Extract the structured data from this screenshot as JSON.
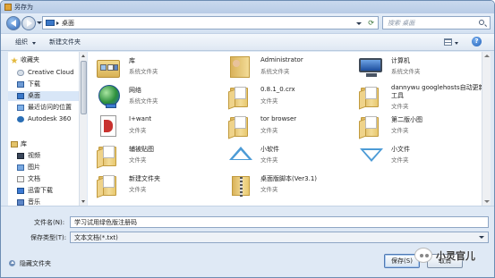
{
  "window": {
    "title": "另存为"
  },
  "address": {
    "location": "桌面",
    "search_placeholder": "搜索 桌面"
  },
  "toolbar": {
    "organize": "组织",
    "new_folder": "新建文件夹",
    "help": "?"
  },
  "nav": {
    "items": [
      {
        "label": "收藏夹",
        "icon": "star-icon",
        "header": true
      },
      {
        "label": "Creative Cloud",
        "icon": "cloud-icon"
      },
      {
        "label": "下载",
        "icon": "download-folder-icon"
      },
      {
        "label": "桌面",
        "icon": "desktop-icon",
        "selected": true
      },
      {
        "label": "最近访问的位置",
        "icon": "recent-places-icon"
      },
      {
        "label": "Autodesk 360",
        "icon": "autodesk-icon"
      },
      {
        "label": "库",
        "icon": "library-icon",
        "header": true
      },
      {
        "label": "视频",
        "icon": "video-library-icon"
      },
      {
        "label": "图片",
        "icon": "picture-library-icon"
      },
      {
        "label": "文档",
        "icon": "document-library-icon"
      },
      {
        "label": "迅雷下载",
        "icon": "thunder-download-icon"
      },
      {
        "label": "音乐",
        "icon": "music-library-icon"
      }
    ]
  },
  "files": [
    {
      "name": "库",
      "type": "系统文件夹",
      "icon": "library-folder-icon"
    },
    {
      "name": "Administrator",
      "type": "系统文件夹",
      "icon": "user-folder-icon"
    },
    {
      "name": "计算机",
      "type": "系统文件夹",
      "icon": "computer-icon"
    },
    {
      "name": "网络",
      "type": "系统文件夹",
      "icon": "network-icon"
    },
    {
      "name": "0.8.1_0.crx",
      "type": "文件夹",
      "icon": "folder-icon"
    },
    {
      "name": "dannywu googlehosts自动更新工具",
      "type": "文件夹",
      "icon": "folder-icon",
      "wrap": true
    },
    {
      "name": "I+want",
      "type": "文件夹",
      "icon": "app-file-icon"
    },
    {
      "name": "tor browser",
      "type": "文件夹",
      "icon": "folder-icon"
    },
    {
      "name": "第二版小图",
      "type": "文件夹",
      "icon": "folder-icon"
    },
    {
      "name": "辅被贴图",
      "type": "文件夹",
      "icon": "folder-icon"
    },
    {
      "name": "小软件",
      "type": "文件夹",
      "icon": "triangle-up-icon"
    },
    {
      "name": "小文件",
      "type": "文件夹",
      "icon": "triangle-down-icon"
    },
    {
      "name": "新建文件夹",
      "type": "文件夹",
      "icon": "folder-icon"
    },
    {
      "name": "桌面版脚本(Ver3.1)",
      "type": "文件夹",
      "icon": "zip-folder-icon"
    }
  ],
  "form": {
    "filename_label": "文件名(N):",
    "filename_value": "学习试用绿色版注册码",
    "filetype_label": "保存类型(T):",
    "filetype_value": "文本文档(*.txt)"
  },
  "footer": {
    "hide_folders": "隐藏文件夹",
    "save": "保存(S)",
    "cancel": "取消"
  },
  "watermark": {
    "text": "小灵官儿"
  },
  "colors": {
    "accent": "#3a78c9",
    "window_bg": "#dfe9f5",
    "folder": "#f3dc97"
  }
}
